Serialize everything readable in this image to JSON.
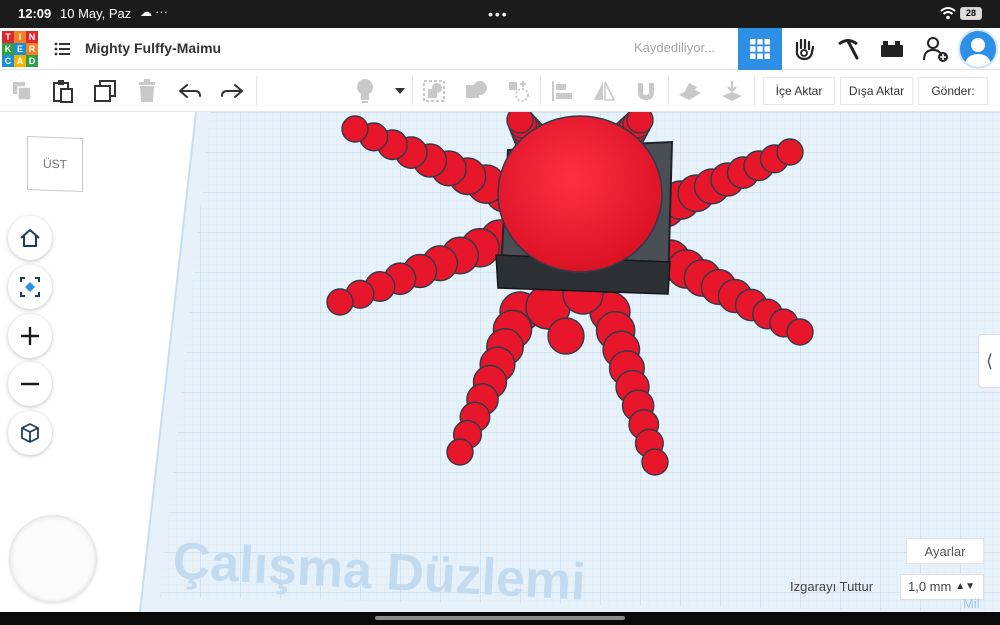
{
  "status_bar": {
    "time": "12:09",
    "date": "10 May, Paz",
    "cloud_icon": "☁",
    "overflow": "···",
    "multitask": "•••",
    "battery": "28"
  },
  "header": {
    "logo_letters": [
      "T",
      "I",
      "N",
      "K",
      "E",
      "R",
      "C",
      "A",
      "D"
    ],
    "logo_colors": [
      "#e1252c",
      "#f58220",
      "#e1252c",
      "#2f9e44",
      "#1a8fd6",
      "#f58220",
      "#1a8fd6",
      "#f5b400",
      "#2f9e44"
    ],
    "project_title": "Mighty Fulffy-Maimu",
    "save_status": "Kaydediliyor...",
    "accent": "#2d8fe6"
  },
  "toolbar": {
    "import_label": "İçe Aktar",
    "export_label": "Dışa Aktar",
    "send_label": "Gönder:"
  },
  "viewcube": {
    "face_label": "ÜST"
  },
  "workplane": {
    "watermark": "Çalışma Düzlemi",
    "settings_label": "Ayarlar",
    "snap_label": "Izgarayı Tuttur",
    "snap_value": "1,0 mm",
    "unit_label": "Mil",
    "model_color": "#e8162a",
    "grid_color": "#c8def0"
  }
}
